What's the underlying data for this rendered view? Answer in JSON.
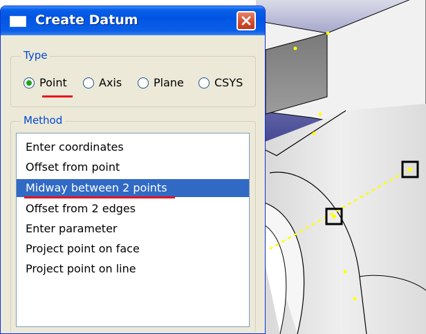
{
  "dialog": {
    "title": "Create Datum",
    "type_legend": "Type",
    "type_options": [
      "Point",
      "Axis",
      "Plane",
      "CSYS"
    ],
    "type_selected": "Point",
    "method_legend": "Method",
    "methods": [
      "Enter coordinates",
      "Offset from point",
      "Midway between 2 points",
      "Offset from 2 edges",
      "Enter parameter",
      "Project point on face",
      "Project point on line"
    ],
    "method_selected": "Midway between 2 points"
  },
  "colors": {
    "titlebar": "#0054e3",
    "dialog_bg": "#ece9d8",
    "legend_text": "#0046d5",
    "selection": "#316ac5",
    "highlight_underline": "#e8121e",
    "viewport_bg": "#2b2f78",
    "model_face": "#e6e6e6",
    "point_marker": "#ffff00"
  },
  "icons": {
    "title_icon": "window-icon",
    "close": "close-icon"
  }
}
